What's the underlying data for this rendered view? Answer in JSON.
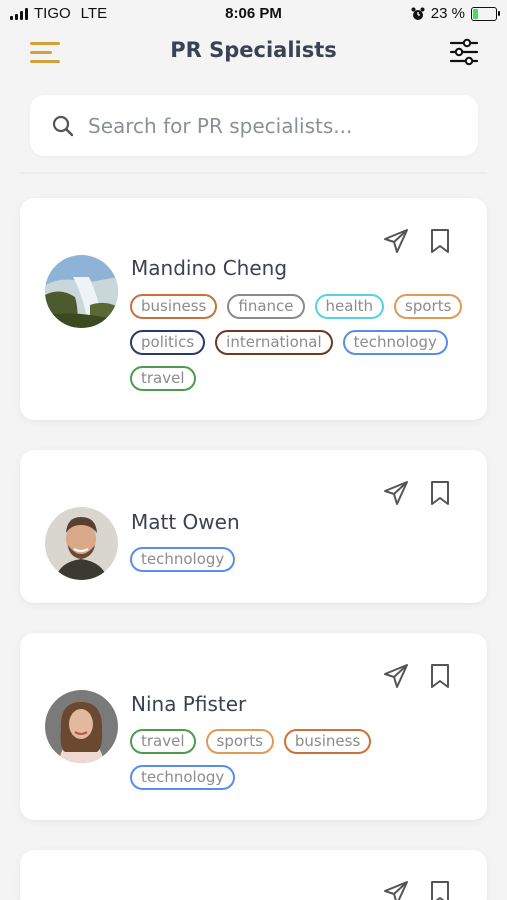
{
  "status_bar": {
    "carrier": "TIGO",
    "network": "LTE",
    "time": "8:06 PM",
    "battery": "23 %",
    "battery_level": 0.23
  },
  "header": {
    "title": "PR Specialists"
  },
  "search": {
    "placeholder": "Search for PR specialists..."
  },
  "colors": {
    "accent": "#d4a03a",
    "business": "#c8713a",
    "finance": "#8a8a8a",
    "health": "#5ad0e6",
    "sports": "#e09a55",
    "politics": "#2c3a6b",
    "international": "#6b3a22",
    "technology": "#5a8de8",
    "travel": "#4e9a4e"
  },
  "specialists": [
    {
      "name": "Mandino Cheng",
      "tags": [
        "business",
        "finance",
        "health",
        "sports",
        "politics",
        "international",
        "technology",
        "travel"
      ]
    },
    {
      "name": "Matt Owen",
      "tags": [
        "technology"
      ]
    },
    {
      "name": "Nina Pfister",
      "tags": [
        "travel",
        "sports",
        "business",
        "technology"
      ]
    }
  ]
}
